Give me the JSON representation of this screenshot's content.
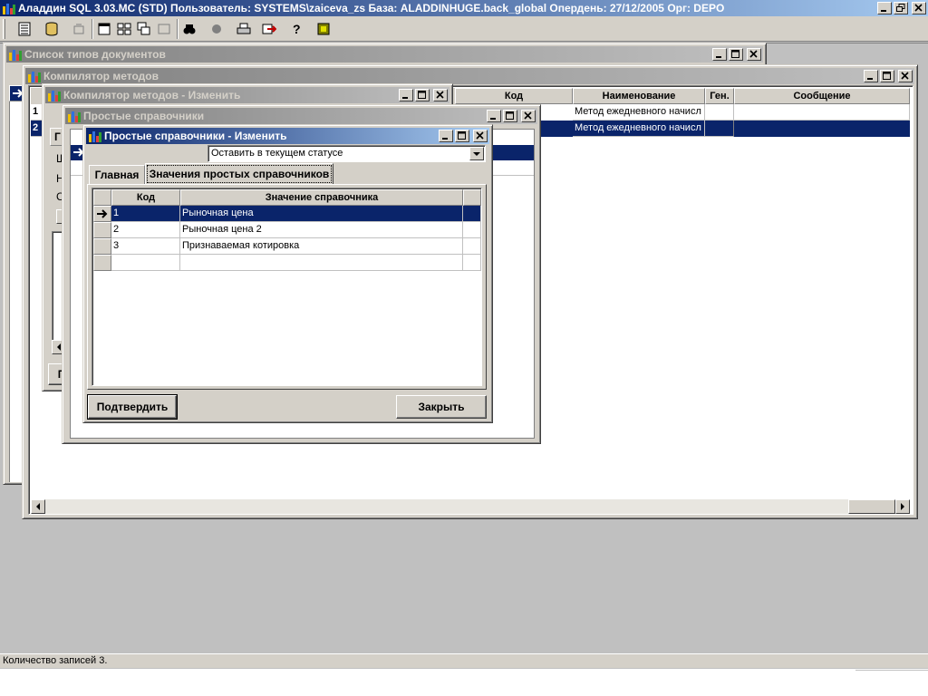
{
  "app": {
    "title": "Аладдин SQL 3.03.MC (STD)  Пользователь: SYSTEMS\\zaiceva_zs База: ALADDINHUGE.back_global Опердень: 27/12/2005 Орг: DEPO"
  },
  "toolbar": {
    "tools": [
      "doc-list-icon",
      "database-icon",
      "disabled-tool-icon",
      "window-icon",
      "tile-icon",
      "cascade-icon",
      "window-disabled-icon",
      "find-icon",
      "stop-icon",
      "print-icon",
      "export-icon",
      "help-icon",
      "exit-icon"
    ]
  },
  "windows": {
    "doc_types": {
      "title": "Список типов документов"
    },
    "compiler": {
      "title": "Компилятор методов",
      "columns": [
        "Код",
        "Наименование",
        "Ген.",
        "Сообщение"
      ],
      "rows": [
        {
          "num": "1",
          "name": "Метод  ежедневного начисл"
        },
        {
          "num": "2",
          "name": "Метод ежедневного начисл"
        }
      ]
    },
    "compiler_edit": {
      "title": "Компилятор методов - Изменить",
      "tab_fragment": "Г",
      "side_letters": [
        "Ш",
        "Н",
        "С"
      ],
      "button_fragment": "П"
    },
    "simple_refs": {
      "title": "Простые справочники"
    },
    "simple_refs_edit": {
      "title": "Простые справочники - Изменить",
      "status_select": "Оставить в текущем статусе",
      "tabs": [
        "Главная",
        "Значения простых справочников"
      ],
      "columns": [
        "Код",
        "Значение справочника"
      ],
      "rows": [
        {
          "code": "1",
          "value": "Рыночная цена"
        },
        {
          "code": "2",
          "value": "Рыночная цена 2"
        },
        {
          "code": "3",
          "value": "Признаваемая котировка"
        }
      ],
      "confirm_label": "Подтвердить",
      "close_label": "Закрыть"
    }
  },
  "status_bar": {
    "text": "Количество записей 3."
  }
}
